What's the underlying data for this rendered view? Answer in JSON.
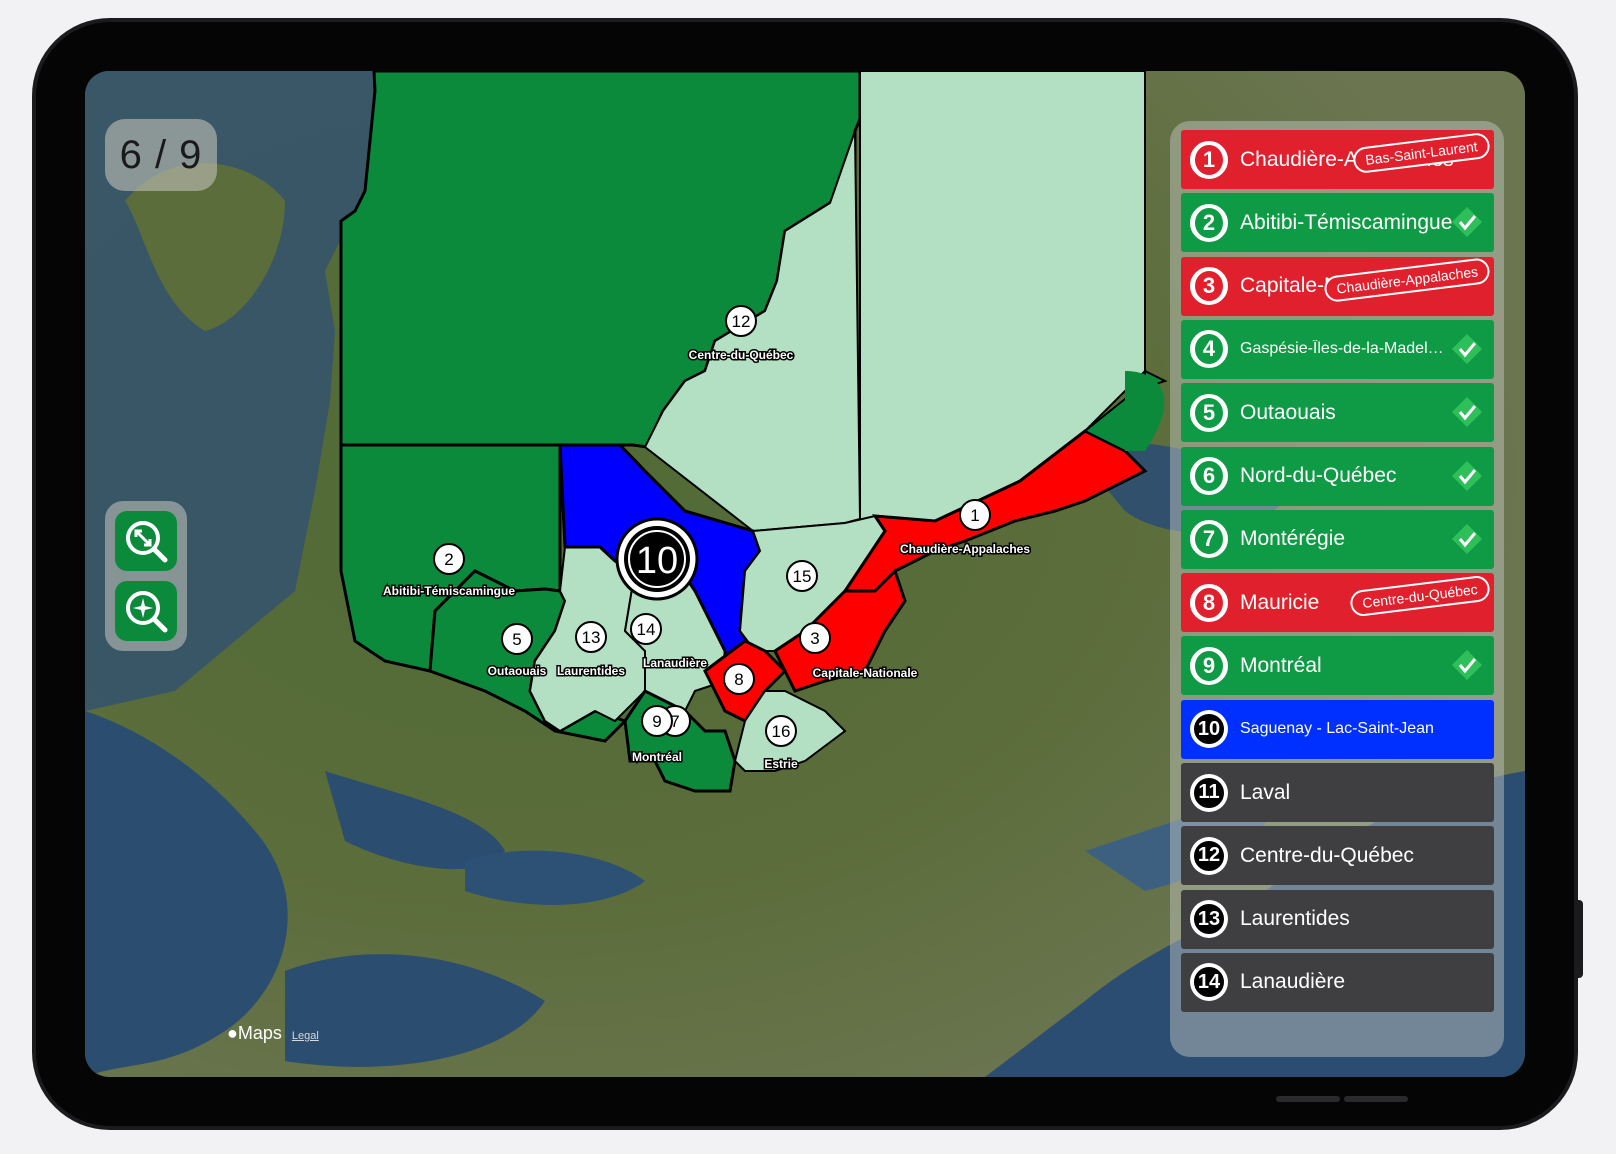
{
  "game": {
    "progress": "6 / 9"
  },
  "map": {
    "attribution": "Maps",
    "legal": "Legal",
    "markers": [
      {
        "num": "1",
        "label": "Chaudière-Appalaches"
      },
      {
        "num": "2",
        "label": "Abitibi-Témiscamingue"
      },
      {
        "num": "3",
        "label": "Capitale-Nationale"
      },
      {
        "num": "5",
        "label": "Outaouais"
      },
      {
        "num": "8",
        "label": ""
      },
      {
        "num": "9",
        "label": "Montréal"
      },
      {
        "num": "7",
        "label": ""
      },
      {
        "num": "10",
        "label": ""
      },
      {
        "num": "12",
        "label": "Centre-du-Québec"
      },
      {
        "num": "13",
        "label": "Laurentides"
      },
      {
        "num": "14",
        "label": "Lanaudière"
      },
      {
        "num": "15",
        "label": ""
      },
      {
        "num": "16",
        "label": "Estrie"
      }
    ]
  },
  "regions": [
    {
      "num": "1",
      "name": "Chaudière-Appalaches",
      "state": "wrong",
      "guess": "Bas-Saint-Laurent"
    },
    {
      "num": "2",
      "name": "Abitibi-Témiscamingue",
      "state": "correct"
    },
    {
      "num": "3",
      "name": "Capitale-Nationale",
      "state": "wrong",
      "guess": "Chaudière-Appalaches"
    },
    {
      "num": "4",
      "name": "Gaspésie-Îles-de-la-Madel…",
      "state": "correct"
    },
    {
      "num": "5",
      "name": "Outaouais",
      "state": "correct"
    },
    {
      "num": "6",
      "name": "Nord-du-Québec",
      "state": "correct"
    },
    {
      "num": "7",
      "name": "Montérégie",
      "state": "correct"
    },
    {
      "num": "8",
      "name": "Mauricie",
      "state": "wrong",
      "guess": "Centre-du-Québec"
    },
    {
      "num": "9",
      "name": "Montréal",
      "state": "correct"
    },
    {
      "num": "10",
      "name": "Saguenay - Lac-Saint-Jean",
      "state": "current"
    },
    {
      "num": "11",
      "name": "Laval",
      "state": "pending"
    },
    {
      "num": "12",
      "name": "Centre-du-Québec",
      "state": "pending"
    },
    {
      "num": "13",
      "name": "Laurentides",
      "state": "pending"
    },
    {
      "num": "14",
      "name": "Lanaudière",
      "state": "pending"
    }
  ],
  "colors": {
    "correct": "#0f9a45",
    "wrong": "#e0202d",
    "current": "#0030ff",
    "pending": "#3f3f41",
    "unanswered_region": "#b3dfc2"
  }
}
